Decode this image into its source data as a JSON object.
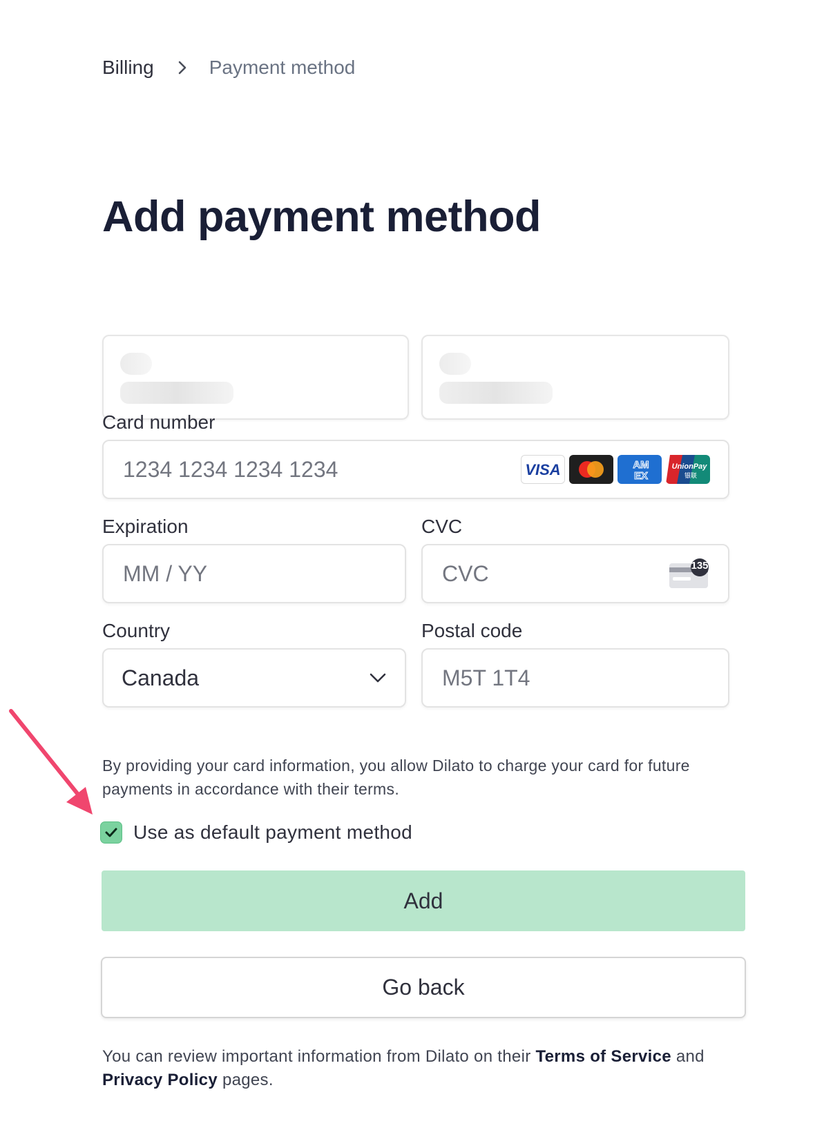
{
  "breadcrumb": {
    "parent": "Billing",
    "current": "Payment method"
  },
  "page_title": "Add payment method",
  "form": {
    "card_number": {
      "label": "Card number",
      "placeholder": "1234 1234 1234 1234"
    },
    "card_brands": [
      "VISA",
      "Mastercard",
      "AMEX",
      "UnionPay"
    ],
    "expiration": {
      "label": "Expiration",
      "placeholder": "MM / YY"
    },
    "cvc": {
      "label": "CVC",
      "placeholder": "CVC",
      "hint_number": "135"
    },
    "country": {
      "label": "Country",
      "value": "Canada"
    },
    "postal_code": {
      "label": "Postal code",
      "placeholder": "M5T 1T4"
    }
  },
  "notice": "By providing your card information, you allow Dilato to charge your card for future payments in accordance with their terms.",
  "default_checkbox": {
    "label": "Use as default payment method",
    "checked": true
  },
  "buttons": {
    "add": "Add",
    "back": "Go back"
  },
  "footer": {
    "prefix": "You can review important information from Dilato on their",
    "terms_link": "Terms of Service",
    "and": "and",
    "privacy_link": "Privacy Policy",
    "suffix": "pages."
  },
  "colors": {
    "accent_green": "#7bd29f",
    "button_green": "#b8e6cc",
    "annotation_arrow": "#f0466e"
  }
}
